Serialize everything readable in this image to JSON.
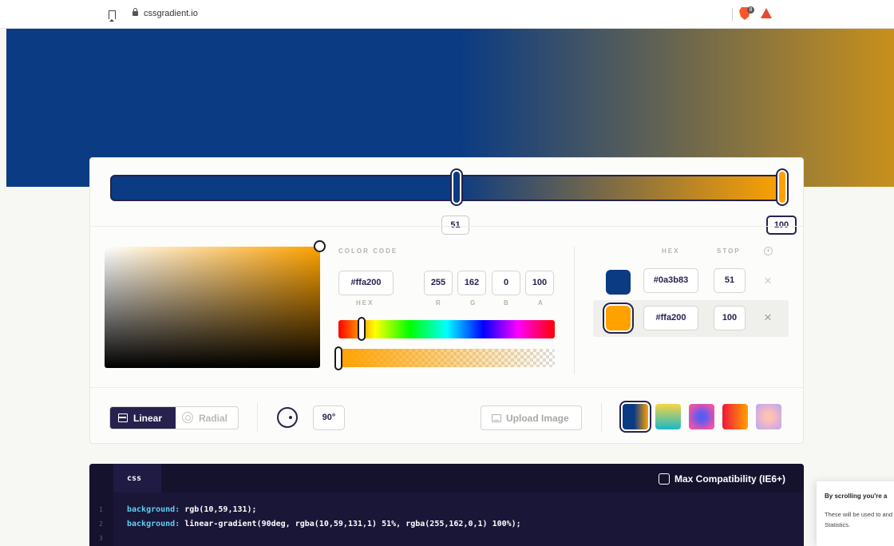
{
  "browser": {
    "url": "cssgradient.io",
    "brave_badge": "8"
  },
  "gradient": {
    "stops": [
      {
        "hex": "#0a3b83",
        "position": 51,
        "color": "#0a3b83"
      },
      {
        "hex": "#ffa200",
        "position": 100,
        "color": "#ffa200"
      }
    ],
    "stop_labels": [
      "51",
      "100"
    ]
  },
  "picker": {
    "color_code_label": "COLOR CODE",
    "hex": "#ffa200",
    "r": "255",
    "g": "162",
    "b": "0",
    "a": "100",
    "hex_label": "HEX",
    "r_label": "R",
    "g_label": "G",
    "b_label": "B",
    "a_label": "A"
  },
  "stops_list": {
    "hex_header": "HEX",
    "stop_header": "STOP",
    "rows": [
      {
        "hex": "#0a3b83",
        "stop": "51"
      },
      {
        "hex": "#ffa200",
        "stop": "100"
      }
    ]
  },
  "controls": {
    "linear_label": "Linear",
    "radial_label": "Radial",
    "angle": "90°",
    "upload_label": "Upload Image"
  },
  "presets": [
    {
      "name": "blue-orange",
      "colors": [
        "#0a3b83",
        "#ffa200"
      ]
    },
    {
      "name": "yellow-teal",
      "colors": [
        "#f7d641",
        "#1bb8c8"
      ]
    },
    {
      "name": "pink-blue",
      "colors": [
        "#f253a6",
        "#5a5cf0"
      ]
    },
    {
      "name": "red-orange",
      "colors": [
        "#f0163c",
        "#ffa200"
      ]
    },
    {
      "name": "lilac-peach",
      "colors": [
        "#c5a7f0",
        "#ffc1b4"
      ]
    }
  ],
  "code": {
    "tab": "css",
    "max_compat": "Max Compatibility (IE6+)",
    "line_numbers": [
      "1",
      "2",
      "3"
    ],
    "line1_prop": "background:",
    "line1_val": " rgb(10,59,131);",
    "line2_prop": "background:",
    "line2_val": " linear-gradient(90deg, rgba(10,59,131,1) 51%, rgba(255,162,0,1) 100%);"
  },
  "cookie": {
    "title": "By scrolling you're a",
    "body": "These will be used to and Statistics."
  }
}
